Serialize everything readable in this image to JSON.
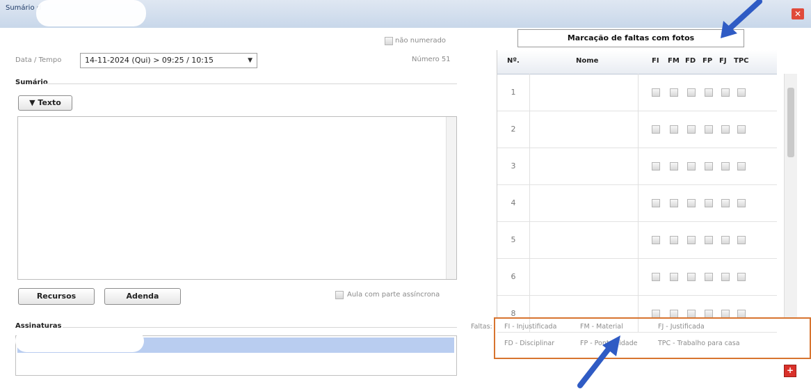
{
  "window": {
    "title": "Sumário d",
    "close_icon": "close-icon"
  },
  "top": {
    "nao_numerado": "não numerado",
    "date_label": "Data / Tempo",
    "date_value": "14-11-2024 (Qui) > 09:25 / 10:15",
    "numero": "Número 51"
  },
  "sumario": {
    "heading": "Sumário",
    "texto_button": "▼ Texto"
  },
  "buttons": {
    "recursos": "Recursos",
    "adenda": "Adenda",
    "aula_assincrona": "Aula com parte assíncrona"
  },
  "assinaturas": {
    "heading": "Assinaturas"
  },
  "faltas": {
    "photo_button": "Marcação de faltas com fotos",
    "columns": [
      "Nº.",
      "Nome",
      "FI",
      "FM",
      "FD",
      "FP",
      "FJ",
      "TPC"
    ],
    "rows": [
      "1",
      "2",
      "3",
      "4",
      "5",
      "6",
      "8"
    ]
  },
  "legend": {
    "prefix": "Faltas:",
    "fi": "FI - Injustificada",
    "fm": "FM - Material",
    "fj": "FJ - Justificada",
    "fd": "FD - Disciplinar",
    "fp": "FP - Pontualidade",
    "tpc": "TPC - Trabalho para casa"
  },
  "colors": {
    "accent_arrow": "#2f5bc4",
    "highlight_border": "#d7742f",
    "selection": "#b9cdf0"
  }
}
